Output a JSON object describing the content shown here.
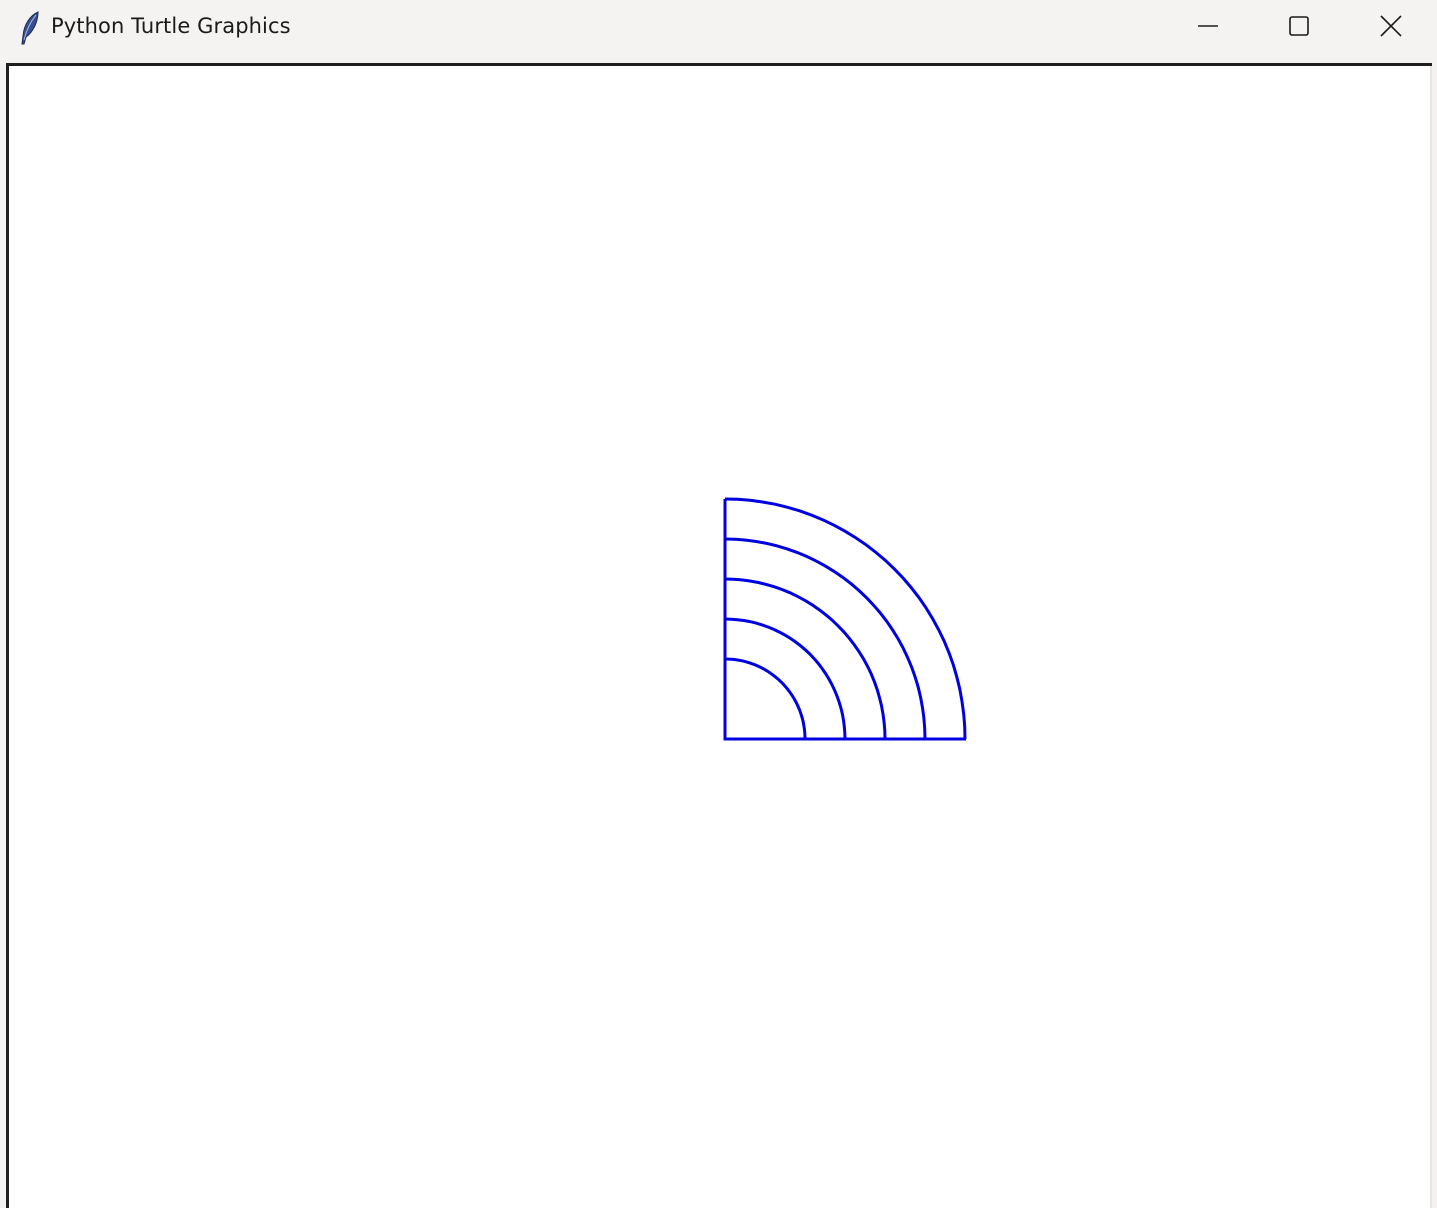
{
  "window": {
    "title": "Python Turtle Graphics",
    "icon": "feather-icon"
  },
  "controls": {
    "minimize": "minimize-icon",
    "maximize": "maximize-icon",
    "close": "close-icon"
  },
  "drawing": {
    "pen_color": "#0000e0",
    "background": "#ffffff",
    "shape": "nested quarter circles",
    "radii": [
      80,
      120,
      160,
      200,
      240
    ]
  }
}
